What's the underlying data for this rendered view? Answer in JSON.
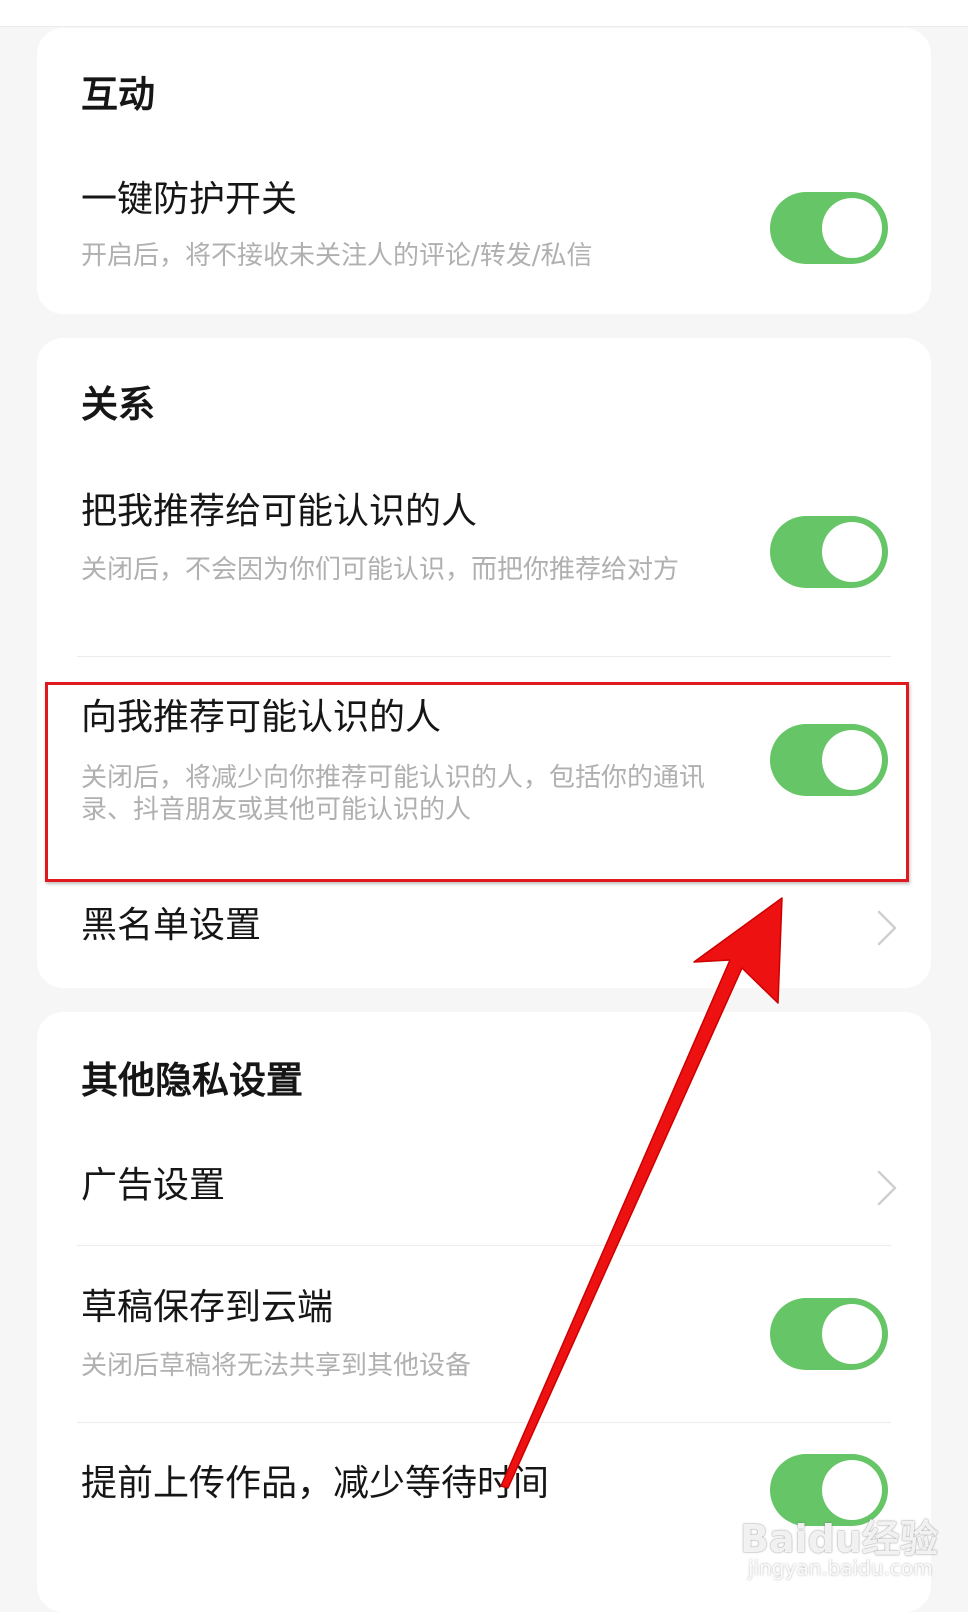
{
  "sections": {
    "interaction": {
      "title": "互动",
      "one_key_protection": {
        "title": "一键防护开关",
        "desc": "开启后，将不接收未关注人的评论/转发/私信",
        "on": true
      }
    },
    "relation": {
      "title": "关系",
      "recommend_me": {
        "title": "把我推荐给可能认识的人",
        "desc": "关闭后，不会因为你们可能认识，而把你推荐给对方",
        "on": true
      },
      "recommend_to_me": {
        "title": "向我推荐可能认识的人",
        "desc": "关闭后，将减少向你推荐可能认识的人，包括你的通讯录、抖音朋友或其他可能认识的人",
        "on": true
      },
      "blacklist": {
        "title": "黑名单设置"
      }
    },
    "other": {
      "title": "其他隐私设置",
      "ad_settings": {
        "title": "广告设置"
      },
      "draft_cloud": {
        "title": "草稿保存到云端",
        "desc": "关闭后草稿将无法共享到其他设备",
        "on": true
      },
      "pre_upload": {
        "title": "提前上传作品，减少等待时间",
        "on": true
      }
    }
  },
  "colors": {
    "toggle_on": "#66c566",
    "highlight": "#e0191f",
    "arrow": "#ee1111"
  },
  "watermark": {
    "main": "Baidu经验",
    "sub": "jingyan.baidu.com"
  }
}
